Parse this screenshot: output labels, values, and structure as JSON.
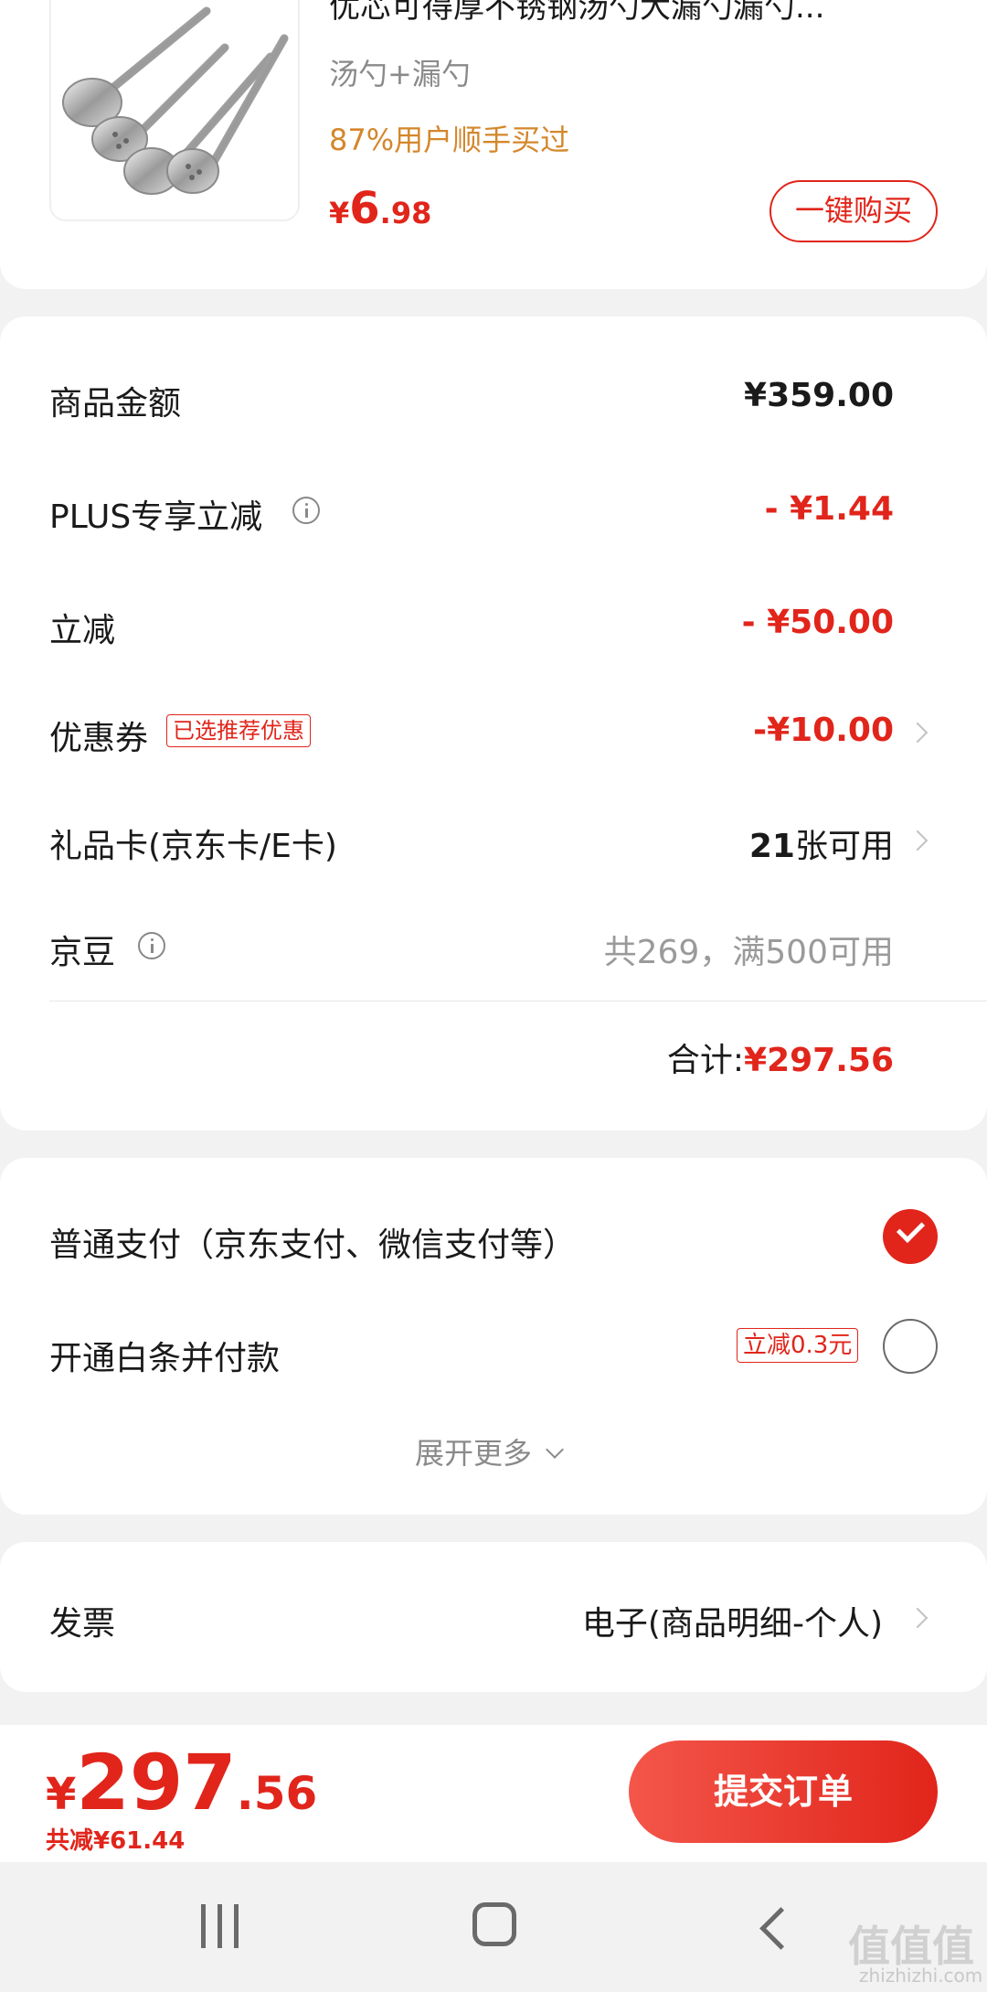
{
  "product": {
    "title": "优芯可得厚不锈钢汤勺大漏勺漏勺...",
    "spec": "汤勺+漏勺",
    "buy_stat": "87%用户顺手买过",
    "price_symbol": "¥",
    "price_int": "6",
    "price_dec": ".98",
    "buy_button": "一键购买"
  },
  "summary": {
    "goods_amount_label": "商品金额",
    "goods_amount_value": "¥359.00",
    "plus_label": "PLUS专享立减",
    "plus_value": "- ¥1.44",
    "instant_label": "立减",
    "instant_value": "- ¥50.00",
    "coupon_label": "优惠券",
    "coupon_tag": "已选推荐优惠",
    "coupon_value": "-¥10.00",
    "giftcard_label": "礼品卡(京东卡/E卡)",
    "giftcard_count": "21",
    "giftcard_suffix": "张可用",
    "jingdou_label": "京豆",
    "jingdou_value": "共269，满500可用",
    "total_label": "合计:",
    "total_value": "¥297.56"
  },
  "payment": {
    "normal_label": "普通支付（京东支付、微信支付等）",
    "baitiao_label": "开通白条并付款",
    "baitiao_tag": "立减0.3元",
    "expand_label": "展开更多"
  },
  "invoice": {
    "label": "发票",
    "value": "电子(商品明细-个人)"
  },
  "bottom": {
    "price_symbol": "¥",
    "price_int": "297",
    "price_dec": ".56",
    "discount": "共减¥61.44",
    "submit": "提交订单"
  },
  "watermark": {
    "logo": "值值值",
    "url": "zhizhizhi.com"
  },
  "colors": {
    "accent": "#e1251b",
    "orange": "#d4872b",
    "background": "#f2f2f2"
  }
}
